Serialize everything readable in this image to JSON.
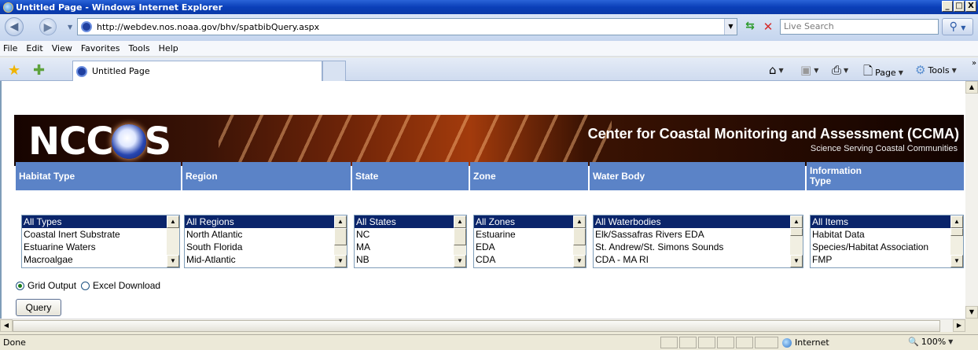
{
  "window": {
    "title": "Untitled Page - Windows Internet Explorer",
    "buttons": [
      "_",
      "□",
      "X"
    ]
  },
  "address": {
    "url": "http://webdev.nos.noaa.gov/bhv/spatbibQuery.aspx",
    "search_placeholder": "Live Search"
  },
  "menu": [
    "File",
    "Edit",
    "View",
    "Favorites",
    "Tools",
    "Help"
  ],
  "tab": {
    "title": "Untitled Page"
  },
  "commands": {
    "page": "Page",
    "tools": "Tools"
  },
  "banner": {
    "logo_left": "NCC",
    "logo_right": "S",
    "noaa_label": "NOAA",
    "title": "Center for Coastal Monitoring and Assessment (CCMA)",
    "subtitle": "Science Serving Coastal Communities"
  },
  "columns": [
    {
      "header": "Habitat Type",
      "items": [
        "All Types",
        "Coastal Inert Substrate",
        "Estuarine Waters",
        "Macroalgae"
      ]
    },
    {
      "header": "Region",
      "items": [
        "All Regions",
        "North Atlantic",
        "South Florida",
        "Mid-Atlantic"
      ]
    },
    {
      "header": "State",
      "items": [
        "All States",
        "NC",
        "MA",
        "NB"
      ]
    },
    {
      "header": "Zone",
      "items": [
        "All Zones",
        "Estuarine",
        "EDA",
        "CDA"
      ]
    },
    {
      "header": "Water Body",
      "items": [
        "All Waterbodies",
        "Elk/Sassafras Rivers EDA",
        "St. Andrew/St. Simons Sounds",
        "CDA - MA RI"
      ]
    },
    {
      "header_line1": "Information",
      "header_line2": "Type",
      "items": [
        "All Items",
        "Habitat Data",
        "Species/Habitat Association",
        "FMP"
      ]
    }
  ],
  "output": {
    "grid_label": "Grid Output",
    "excel_label": "Excel Download",
    "selected": "grid"
  },
  "query_button": "Query",
  "status": {
    "text": "Done",
    "zone": "Internet",
    "zoom": "100%"
  },
  "colors": {
    "header_blue": "#5b83c7",
    "selection": "#0a246a",
    "titlebar": "#0a3fb8"
  }
}
